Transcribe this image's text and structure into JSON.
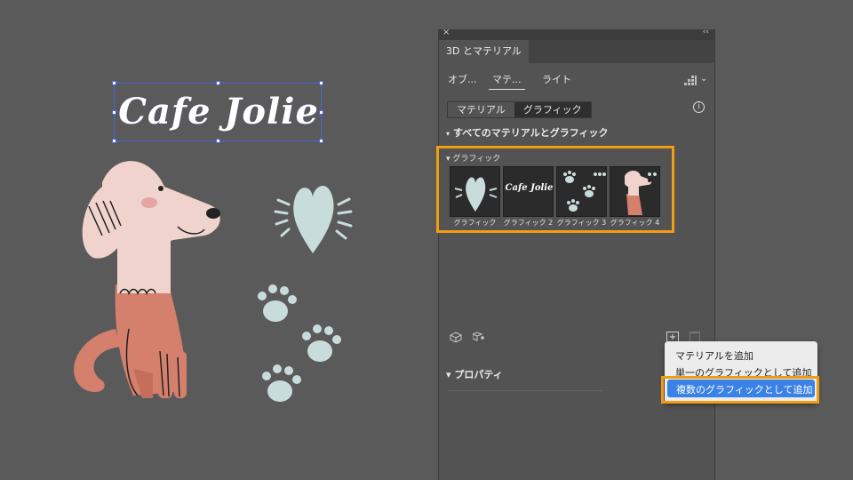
{
  "canvas": {
    "logo_text": "Cafe Jolie"
  },
  "panel": {
    "title_tab": "3D とマテリアル",
    "close_icon": "×",
    "collapse_icon": "‹‹",
    "subtabs": [
      "オブ...",
      "マテ...",
      "ライト"
    ],
    "segment": [
      "マテリアル",
      "グラフィック"
    ],
    "info_icon": "i",
    "section_all": "すべてのマテリアルとグラフィック",
    "graphics_group": "グラフィック",
    "thumbs": [
      {
        "caption": "グラフィック"
      },
      {
        "caption": "グラフィック 2",
        "logo": "Cafe Jolie"
      },
      {
        "caption": "グラフィック 3"
      },
      {
        "caption": "グラフィック 4"
      }
    ],
    "add_icon": "+",
    "properties": "プロパティ"
  },
  "menu": {
    "items": [
      "マテリアルを追加",
      "単一のグラフィックとして追加",
      "複数のグラフィックとして追加"
    ],
    "selected_index": 2
  },
  "colors": {
    "highlight": "#f39c12",
    "menu_selected": "#3a82e6",
    "dog_body": "#efd3cc",
    "dog_sweater": "#d5806d",
    "accent_icons": "#c9dcdc"
  }
}
